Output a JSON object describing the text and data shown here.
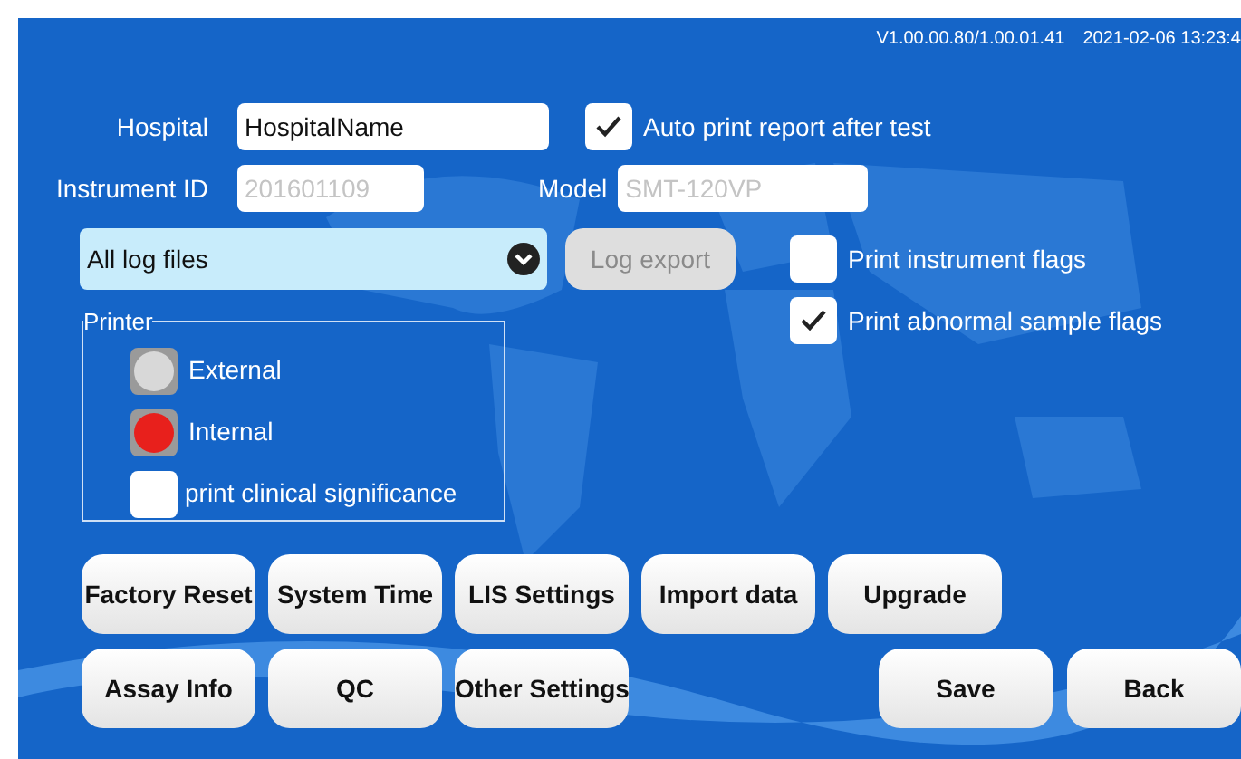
{
  "status_bar": {
    "version": "V1.00.00.80/1.00.01.41",
    "datetime": "2021-02-06 13:23:4"
  },
  "hospital": {
    "label": "Hospital",
    "value": "HospitalName"
  },
  "auto_print": {
    "label": "Auto print report after test",
    "checked": true
  },
  "instrument_id": {
    "label": "Instrument ID",
    "value": "201601109",
    "disabled": true
  },
  "model": {
    "label": "Model",
    "value": "SMT-120VP",
    "disabled": true
  },
  "log_select": {
    "value": "All log files"
  },
  "log_export": {
    "label": "Log export",
    "disabled": true
  },
  "flags": [
    {
      "label": "Print instrument flags",
      "checked": false
    },
    {
      "label": "Print abnormal sample flags",
      "checked": true
    }
  ],
  "printer": {
    "title": "Printer",
    "options": [
      {
        "label": "External",
        "selected": false
      },
      {
        "label": "Internal",
        "selected": true
      }
    ],
    "clinical": {
      "label": "print clinical significance",
      "checked": false
    }
  },
  "buttons_row_1": [
    "Factory Reset",
    "System Time",
    "LIS Settings",
    "Import data",
    "Upgrade"
  ],
  "buttons_row_2": [
    "Assay Info",
    "QC",
    "Other Settings"
  ],
  "footer_buttons": [
    "Save",
    "Back"
  ]
}
